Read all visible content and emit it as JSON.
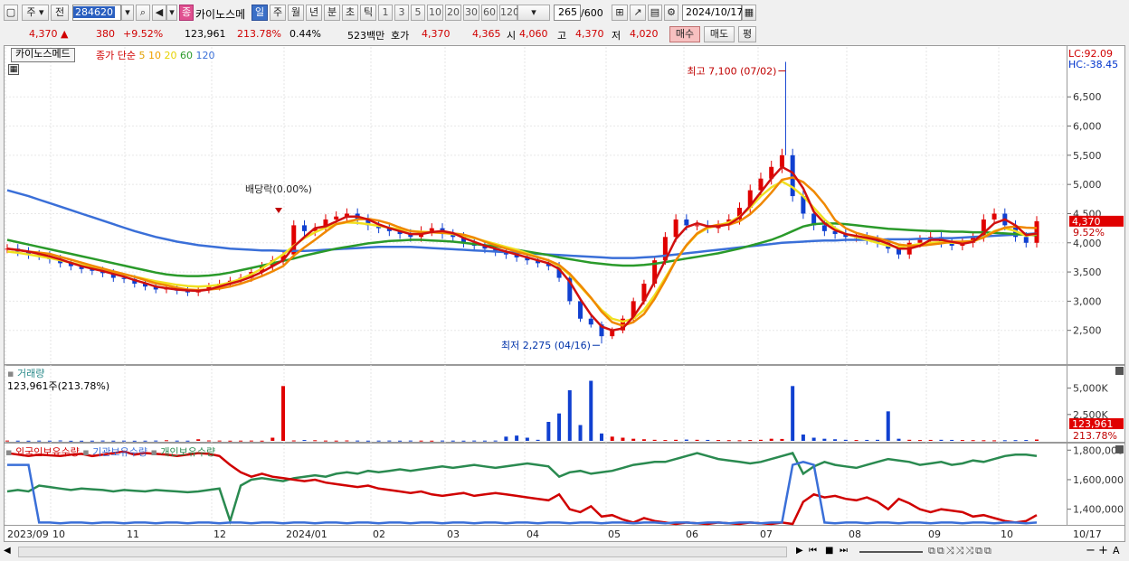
{
  "toolbar": {
    "market": "주",
    "prev": "전",
    "code": "284620",
    "name_badge": "종",
    "stock_name": "카이노스메",
    "periods": [
      "일",
      "주",
      "월",
      "년",
      "분",
      "초",
      "틱"
    ],
    "selected_period": "일",
    "intervals": [
      "1",
      "3",
      "5",
      "10",
      "20",
      "30",
      "60",
      "120"
    ],
    "count": "265",
    "count_total": "/600",
    "date": "2024/10/17"
  },
  "quote": {
    "price": "4,370 ▲",
    "change": "380",
    "change_pct": "+9.52%",
    "volume": "123,961",
    "volume_pct": "213.78%",
    "turnover_pct": "0.44%",
    "amount": "523백만",
    "label_ask": "호가",
    "ask": "4,370",
    "bid": "4,365",
    "label_open": "시",
    "open": "4,060",
    "label_high": "고",
    "high": "4,370",
    "label_low": "저",
    "low": "4,020",
    "buy": "매수",
    "sell": "매도",
    "eval": "평"
  },
  "price_panel": {
    "legend_box": "카이노스메드",
    "legend_label": "종가 단순",
    "ma_labels": [
      {
        "t": "5",
        "c": "#e0a000"
      },
      {
        "t": "10",
        "c": "#f0a000"
      },
      {
        "t": "20",
        "c": "#e6d200"
      },
      {
        "t": "60",
        "c": "#2a9a2a"
      },
      {
        "t": "120",
        "c": "#3a6fd8"
      }
    ],
    "lc": "LC:92.09",
    "hc": "HC:-38.45",
    "price_tag": "4,370",
    "pct_tag": "9.52%",
    "annot_high": "최고 7,100 (07/02)",
    "annot_low": "최저 2,275 (04/16)",
    "annot_div": "배당락(0.00%)"
  },
  "volume_panel": {
    "title": "거래량",
    "value": "123,961주(213.78%)",
    "tag": "123,961",
    "tag_pct": "213.78%",
    "ticks": [
      "5,000K",
      "2,500K"
    ]
  },
  "holdings_panel": {
    "series": [
      {
        "name": "외국인보유수량",
        "color": "#d00000"
      },
      {
        "name": "기관보유수량",
        "color": "#3a6fd8"
      },
      {
        "name": "개인보유수량",
        "color": "#2a8a50"
      }
    ],
    "ticks": [
      "1,800,000",
      "1,600,000",
      "1,400,000"
    ]
  },
  "x_axis": {
    "labels": [
      "2023/09",
      "10",
      "11",
      "12",
      "2024/01",
      "02",
      "03",
      "04",
      "05",
      "06",
      "07",
      "08",
      "09",
      "10"
    ],
    "end": "10/17"
  },
  "chart_data": {
    "type": "line",
    "title": "",
    "ylim": [
      2000,
      7200
    ],
    "yticks": [
      2500,
      3000,
      3500,
      4000,
      4500,
      5000,
      5500,
      6000,
      6500
    ],
    "months": [
      "2023/09",
      "10",
      "11",
      "12",
      "2024/01",
      "02",
      "03",
      "04",
      "05",
      "06",
      "07",
      "08",
      "09",
      "10"
    ],
    "close": [
      3900,
      3850,
      3800,
      3780,
      3720,
      3650,
      3600,
      3550,
      3520,
      3480,
      3400,
      3380,
      3300,
      3250,
      3200,
      3220,
      3180,
      3150,
      3200,
      3250,
      3300,
      3350,
      3400,
      3500,
      3600,
      3700,
      3800,
      4300,
      4200,
      4250,
      4400,
      4450,
      4500,
      4400,
      4300,
      4250,
      4200,
      4150,
      4100,
      4200,
      4250,
      4150,
      4100,
      4000,
      3950,
      3900,
      3850,
      3800,
      3750,
      3700,
      3650,
      3600,
      3400,
      3000,
      2700,
      2600,
      2400,
      2500,
      2700,
      3000,
      3300,
      3700,
      4100,
      4400,
      4300,
      4300,
      4250,
      4300,
      4400,
      4600,
      4900,
      5100,
      5300,
      5500,
      4800,
      4500,
      4300,
      4200,
      4150,
      4100,
      4100,
      4050,
      4000,
      3900,
      3800,
      4000,
      4050,
      4100,
      4000,
      3950,
      4000,
      4100,
      4400,
      4500,
      4300,
      4100,
      4000,
      4370
    ],
    "ma20": [
      3850,
      3830,
      3800,
      3770,
      3740,
      3700,
      3660,
      3620,
      3580,
      3540,
      3500,
      3460,
      3420,
      3380,
      3340,
      3310,
      3280,
      3260,
      3250,
      3260,
      3280,
      3320,
      3380,
      3460,
      3560,
      3680,
      3800,
      3950,
      4080,
      4180,
      4260,
      4320,
      4350,
      4340,
      4320,
      4290,
      4260,
      4230,
      4200,
      4190,
      4180,
      4170,
      4150,
      4120,
      4080,
      4030,
      3980,
      3930,
      3880,
      3820,
      3760,
      3700,
      3600,
      3450,
      3250,
      3050,
      2850,
      2700,
      2650,
      2700,
      2850,
      3100,
      3400,
      3700,
      3950,
      4150,
      4250,
      4300,
      4350,
      4450,
      4600,
      4800,
      4950,
      5050,
      4950,
      4800,
      4600,
      4400,
      4250,
      4150,
      4100,
      4050,
      4000,
      3950,
      3930,
      3950,
      3980,
      4000,
      4010,
      4000,
      4000,
      4020,
      4100,
      4200,
      4250,
      4200,
      4120,
      4150
    ],
    "ma60": [
      4050,
      4010,
      3970,
      3930,
      3890,
      3850,
      3810,
      3770,
      3730,
      3690,
      3650,
      3610,
      3570,
      3530,
      3490,
      3460,
      3440,
      3430,
      3430,
      3440,
      3460,
      3490,
      3530,
      3570,
      3610,
      3650,
      3690,
      3730,
      3780,
      3820,
      3860,
      3900,
      3930,
      3960,
      3990,
      4010,
      4030,
      4040,
      4050,
      4050,
      4040,
      4030,
      4020,
      4000,
      3980,
      3960,
      3940,
      3910,
      3880,
      3850,
      3820,
      3790,
      3750,
      3720,
      3690,
      3660,
      3640,
      3620,
      3610,
      3610,
      3620,
      3640,
      3670,
      3700,
      3730,
      3760,
      3790,
      3820,
      3860,
      3900,
      3950,
      4000,
      4050,
      4120,
      4200,
      4280,
      4320,
      4330,
      4330,
      4320,
      4300,
      4280,
      4260,
      4240,
      4230,
      4220,
      4210,
      4200,
      4200,
      4190,
      4190,
      4180,
      4180,
      4170,
      4160,
      4150,
      4140,
      4130
    ],
    "ma120": [
      4900,
      4850,
      4800,
      4740,
      4680,
      4620,
      4560,
      4500,
      4440,
      4380,
      4320,
      4260,
      4200,
      4150,
      4100,
      4060,
      4020,
      3990,
      3960,
      3940,
      3920,
      3900,
      3890,
      3880,
      3870,
      3870,
      3860,
      3860,
      3860,
      3870,
      3880,
      3890,
      3900,
      3910,
      3920,
      3930,
      3930,
      3930,
      3930,
      3920,
      3910,
      3900,
      3890,
      3880,
      3870,
      3860,
      3850,
      3840,
      3830,
      3820,
      3810,
      3800,
      3790,
      3780,
      3770,
      3760,
      3750,
      3740,
      3740,
      3740,
      3750,
      3760,
      3780,
      3800,
      3820,
      3840,
      3860,
      3880,
      3900,
      3920,
      3940,
      3960,
      3980,
      4000,
      4010,
      4020,
      4030,
      4040,
      4040,
      4050,
      4050,
      4050,
      4050,
      4060,
      4060,
      4060,
      4070,
      4070,
      4080,
      4080,
      4090,
      4100,
      4110,
      4120,
      4130,
      4140,
      4150,
      4160
    ],
    "high_label": {
      "value": 7100,
      "date": "07/02"
    },
    "low_label": {
      "value": 2275,
      "date": "04/16"
    },
    "volume_k": [
      30,
      20,
      15,
      25,
      20,
      40,
      10,
      15,
      20,
      30,
      20,
      25,
      15,
      20,
      30,
      60,
      25,
      20,
      150,
      40,
      30,
      20,
      25,
      30,
      20,
      300,
      5200,
      40,
      80,
      60,
      30,
      25,
      40,
      30,
      20,
      25,
      30,
      20,
      30,
      25,
      20,
      30,
      25,
      20,
      30,
      25,
      30,
      400,
      500,
      300,
      100,
      1800,
      2600,
      4800,
      1500,
      5700,
      700,
      400,
      300,
      200,
      150,
      100,
      80,
      100,
      120,
      100,
      90,
      80,
      70,
      60,
      80,
      100,
      200,
      180,
      5200,
      600,
      300,
      200,
      150,
      100,
      80,
      90,
      100,
      2800,
      200,
      100,
      80,
      90,
      100,
      90,
      80,
      70,
      60,
      50,
      60,
      70,
      80,
      124
    ],
    "foreign": [
      1780,
      1770,
      1760,
      1770,
      1765,
      1760,
      1770,
      1775,
      1760,
      1770,
      1780,
      1790,
      1770,
      1780,
      1775,
      1770,
      1760,
      1770,
      1780,
      1775,
      1760,
      1700,
      1650,
      1620,
      1640,
      1620,
      1610,
      1600,
      1590,
      1600,
      1580,
      1570,
      1560,
      1550,
      1560,
      1540,
      1530,
      1520,
      1510,
      1520,
      1500,
      1490,
      1500,
      1510,
      1490,
      1500,
      1510,
      1500,
      1490,
      1480,
      1470,
      1460,
      1500,
      1400,
      1380,
      1420,
      1350,
      1360,
      1330,
      1310,
      1340,
      1320,
      1310,
      1300,
      1310,
      1305,
      1300,
      1310,
      1305,
      1300,
      1310,
      1305,
      1300,
      1310,
      1300,
      1450,
      1500,
      1480,
      1490,
      1470,
      1460,
      1480,
      1450,
      1400,
      1470,
      1440,
      1400,
      1380,
      1400,
      1390,
      1380,
      1350,
      1360,
      1340,
      1320,
      1310,
      1320,
      1360
    ],
    "institution": [
      1700,
      1700,
      1700,
      1310,
      1310,
      1305,
      1310,
      1310,
      1305,
      1310,
      1310,
      1305,
      1310,
      1310,
      1305,
      1310,
      1310,
      1305,
      1310,
      1310,
      1305,
      1310,
      1310,
      1305,
      1310,
      1310,
      1305,
      1310,
      1310,
      1305,
      1310,
      1310,
      1305,
      1310,
      1310,
      1305,
      1310,
      1310,
      1305,
      1310,
      1310,
      1305,
      1310,
      1310,
      1305,
      1310,
      1310,
      1305,
      1310,
      1310,
      1305,
      1310,
      1310,
      1305,
      1310,
      1310,
      1305,
      1310,
      1310,
      1305,
      1310,
      1310,
      1305,
      1310,
      1310,
      1305,
      1310,
      1310,
      1305,
      1310,
      1310,
      1305,
      1310,
      1310,
      1700,
      1720,
      1700,
      1310,
      1305,
      1310,
      1310,
      1305,
      1310,
      1310,
      1305,
      1310,
      1310,
      1305,
      1310,
      1310,
      1305,
      1310,
      1310,
      1305,
      1310,
      1310,
      1305,
      1310
    ],
    "individual": [
      1520,
      1530,
      1520,
      1560,
      1550,
      1540,
      1530,
      1540,
      1535,
      1530,
      1520,
      1530,
      1525,
      1520,
      1530,
      1525,
      1520,
      1515,
      1520,
      1530,
      1540,
      1320,
      1560,
      1600,
      1610,
      1600,
      1590,
      1610,
      1620,
      1630,
      1620,
      1640,
      1650,
      1640,
      1660,
      1650,
      1660,
      1670,
      1660,
      1670,
      1680,
      1690,
      1680,
      1690,
      1700,
      1690,
      1680,
      1690,
      1700,
      1710,
      1700,
      1690,
      1620,
      1650,
      1660,
      1640,
      1650,
      1660,
      1680,
      1700,
      1710,
      1720,
      1720,
      1740,
      1760,
      1780,
      1760,
      1740,
      1730,
      1720,
      1710,
      1720,
      1740,
      1760,
      1780,
      1640,
      1690,
      1720,
      1700,
      1690,
      1680,
      1700,
      1720,
      1740,
      1730,
      1720,
      1700,
      1710,
      1720,
      1700,
      1710,
      1730,
      1720,
      1740,
      1760,
      1770,
      1770,
      1760
    ]
  }
}
